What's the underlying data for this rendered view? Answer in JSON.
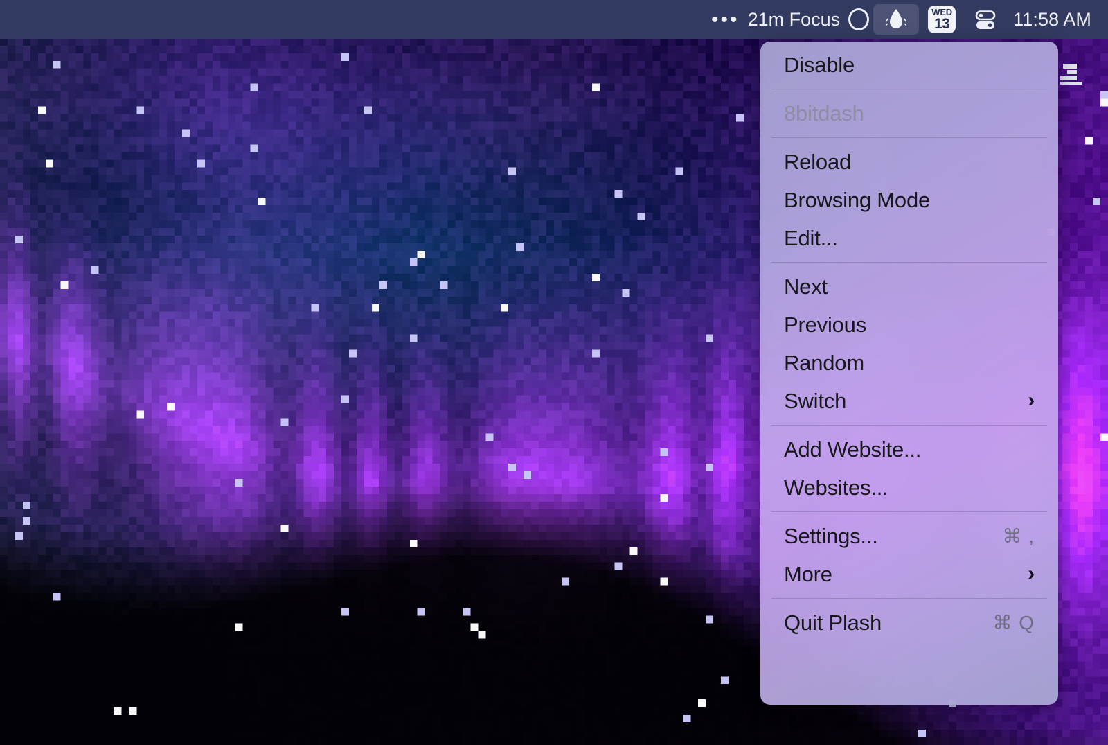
{
  "menubar": {
    "background_color": "#333a60",
    "items": [
      {
        "name": "overflow-ellipsis",
        "label": "•••"
      },
      {
        "name": "focus-status",
        "label": "21m Focus"
      },
      {
        "name": "plash-status-icon",
        "label": ""
      },
      {
        "name": "calendar-icon",
        "dow": "WED",
        "day": "13"
      },
      {
        "name": "control-center-icon",
        "label": ""
      },
      {
        "name": "clock",
        "label": "11:58 AM"
      }
    ],
    "focus_label": "21m Focus",
    "calendar": {
      "dow": "WED",
      "day": "13"
    },
    "clock": "11:58 AM"
  },
  "plash_menu": {
    "accent_color": "#b7a8e0",
    "groups": [
      {
        "items": [
          {
            "label": "Disable",
            "shortcut": "",
            "submenu": false,
            "dim": false
          }
        ]
      },
      {
        "items": [
          {
            "label": "8bitdash",
            "shortcut": "",
            "submenu": false,
            "dim": true
          }
        ]
      },
      {
        "items": [
          {
            "label": "Reload",
            "shortcut": "",
            "submenu": false,
            "dim": false
          },
          {
            "label": "Browsing Mode",
            "shortcut": "",
            "submenu": false,
            "dim": false
          },
          {
            "label": "Edit...",
            "shortcut": "",
            "submenu": false,
            "dim": false
          }
        ]
      },
      {
        "items": [
          {
            "label": "Next",
            "shortcut": "",
            "submenu": false,
            "dim": false
          },
          {
            "label": "Previous",
            "shortcut": "",
            "submenu": false,
            "dim": false
          },
          {
            "label": "Random",
            "shortcut": "",
            "submenu": false,
            "dim": false
          },
          {
            "label": "Switch",
            "shortcut": "",
            "submenu": true,
            "dim": false
          }
        ]
      },
      {
        "items": [
          {
            "label": "Add Website...",
            "shortcut": "",
            "submenu": false,
            "dim": false
          },
          {
            "label": "Websites...",
            "shortcut": "",
            "submenu": false,
            "dim": false
          }
        ]
      },
      {
        "items": [
          {
            "label": "Settings...",
            "shortcut": "⌘ ,",
            "submenu": false,
            "dim": false
          },
          {
            "label": "More",
            "shortcut": "",
            "submenu": true,
            "dim": false
          }
        ]
      },
      {
        "items": [
          {
            "label": "Quit Plash",
            "shortcut": "⌘ Q",
            "submenu": false,
            "dim": false
          }
        ]
      }
    ]
  },
  "desktop": {
    "wallpaper_description": "pixelated mosaic aurora night sky",
    "palette": [
      "#05030f",
      "#0d1038",
      "#1b2064",
      "#2a1468",
      "#4a1d8e",
      "#7a33c2",
      "#a05ce0",
      "#c08cf0",
      "#0a2a55",
      "#123a70",
      "#ffffff"
    ]
  }
}
